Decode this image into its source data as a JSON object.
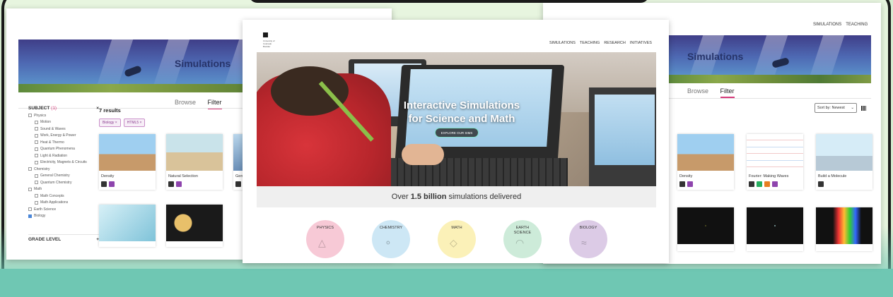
{
  "left_page": {
    "banner_title": "Simulations",
    "tabs": [
      {
        "label": "Browse"
      },
      {
        "label": "Filter"
      }
    ],
    "filters": {
      "subject_label": "SUBJECT",
      "subject_count": "(1)",
      "subject_close": "×",
      "items": [
        {
          "label": "Physics",
          "level": 0,
          "checked": false
        },
        {
          "label": "Motion",
          "level": 1,
          "checked": false
        },
        {
          "label": "Sound & Waves",
          "level": 1,
          "checked": false
        },
        {
          "label": "Work, Energy & Power",
          "level": 1,
          "checked": false
        },
        {
          "label": "Heat & Thermo",
          "level": 1,
          "checked": false
        },
        {
          "label": "Quantum Phenomena",
          "level": 1,
          "checked": false
        },
        {
          "label": "Light & Radiation",
          "level": 1,
          "checked": false
        },
        {
          "label": "Electricity, Magnets & Circuits",
          "level": 1,
          "checked": false
        },
        {
          "label": "Chemistry",
          "level": 0,
          "checked": false
        },
        {
          "label": "General Chemistry",
          "level": 1,
          "checked": false
        },
        {
          "label": "Quantum Chemistry",
          "level": 1,
          "checked": false
        },
        {
          "label": "Math",
          "level": 0,
          "checked": false
        },
        {
          "label": "Math Concepts",
          "level": 1,
          "checked": false
        },
        {
          "label": "Math Applications",
          "level": 1,
          "checked": false
        },
        {
          "label": "Earth Science",
          "level": 0,
          "checked": false
        },
        {
          "label": "Biology",
          "level": 0,
          "checked": true
        }
      ],
      "grade_level_label": "GRADE LEVEL",
      "grade_level_toggle": "+"
    },
    "results_label": "7 results",
    "chips": [
      {
        "label": "Biology ×"
      },
      {
        "label": "HTML5 ×"
      }
    ],
    "sims": [
      {
        "name": "Density"
      },
      {
        "name": "Natural Selection"
      },
      {
        "name": "Gen Essen"
      }
    ]
  },
  "middle_page": {
    "logo_text": "University of Colorado Boulder",
    "nav": [
      {
        "label": "SIMULATIONS"
      },
      {
        "label": "TEACHING"
      },
      {
        "label": "RESEARCH"
      },
      {
        "label": "INITIATIVES"
      }
    ],
    "hero_title_line1": "Interactive Simulations",
    "hero_title_line2": "for Science and Math",
    "hero_button": "EXPLORE OUR SIMS",
    "stat_prefix": "Over",
    "stat_value": "1.5 billion",
    "stat_suffix": "simulations delivered",
    "subjects": [
      {
        "label": "PHYSICS",
        "color": "#f7c9d6"
      },
      {
        "label": "CHEMISTRY",
        "color": "#cde7f5"
      },
      {
        "label": "MATH",
        "color": "#fbf1b8"
      },
      {
        "label": "EARTH SCIENCE",
        "color": "#cdebd9"
      },
      {
        "label": "BIOLOGY",
        "color": "#dccbe6"
      }
    ]
  },
  "right_page": {
    "nav": [
      {
        "label": "SIMULATIONS"
      },
      {
        "label": "TEACHING"
      }
    ],
    "banner_title": "Simulations",
    "tabs": [
      {
        "label": "Browse"
      },
      {
        "label": "Filter"
      }
    ],
    "sort_label": "Sort by: Newest",
    "sims": [
      {
        "name": "Density"
      },
      {
        "name": "Fourier: Making Waves"
      },
      {
        "name": "Build a Molecule"
      }
    ]
  },
  "colors": {
    "accent_pink": "#d63a7a",
    "banner_text": "#27346a",
    "frame_border": "#1a1a1a",
    "teal": "#6fc7b3"
  }
}
